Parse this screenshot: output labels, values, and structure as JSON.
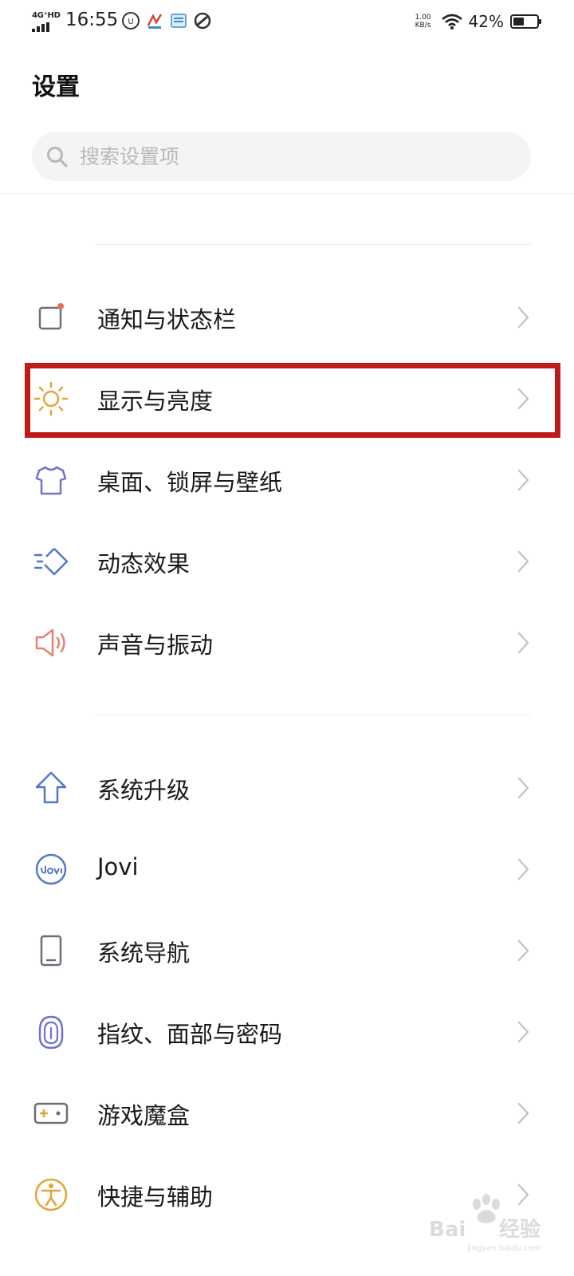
{
  "status_bar": {
    "network": "4G⁺HD",
    "time": "16:55",
    "speed_value": "1.00",
    "speed_unit": "KB/s",
    "battery_percent": "42%"
  },
  "page": {
    "title": "设置"
  },
  "search": {
    "placeholder": "搜索设置项"
  },
  "settings_groups": [
    {
      "items": [
        {
          "label": "通知与状态栏",
          "icon": "notification-icon",
          "color": "#6b6f7a",
          "accent": "#e9705a"
        },
        {
          "label": "显示与亮度",
          "icon": "brightness-sun-icon",
          "color": "#e3a43a"
        },
        {
          "label": "桌面、锁屏与壁纸",
          "icon": "tshirt-icon",
          "color": "#6f73c9"
        },
        {
          "label": "动态效果",
          "icon": "motion-effect-icon",
          "color": "#4f79c9"
        },
        {
          "label": "声音与振动",
          "icon": "speaker-icon",
          "color": "#e28471"
        }
      ]
    },
    {
      "items": [
        {
          "label": "系统升级",
          "icon": "upgrade-arrow-icon",
          "color": "#4f79c9"
        },
        {
          "label": "Jovi",
          "icon": "jovi-icon",
          "color": "#4f79c9"
        },
        {
          "label": "系统导航",
          "icon": "phone-navigation-icon",
          "color": "#6b6f7a"
        },
        {
          "label": "指纹、面部与密码",
          "icon": "fingerprint-icon",
          "color": "#6f73c9"
        },
        {
          "label": "游戏魔盒",
          "icon": "game-box-icon",
          "color": "#6b6f7a",
          "accent": "#e3a43a"
        },
        {
          "label": "快捷与辅助",
          "icon": "accessibility-icon",
          "color": "#e3a43a"
        }
      ]
    }
  ],
  "highlighted_item": "显示与亮度",
  "watermark": {
    "text": "Baidu经验",
    "subtext": "jingyan.baidu.com"
  }
}
